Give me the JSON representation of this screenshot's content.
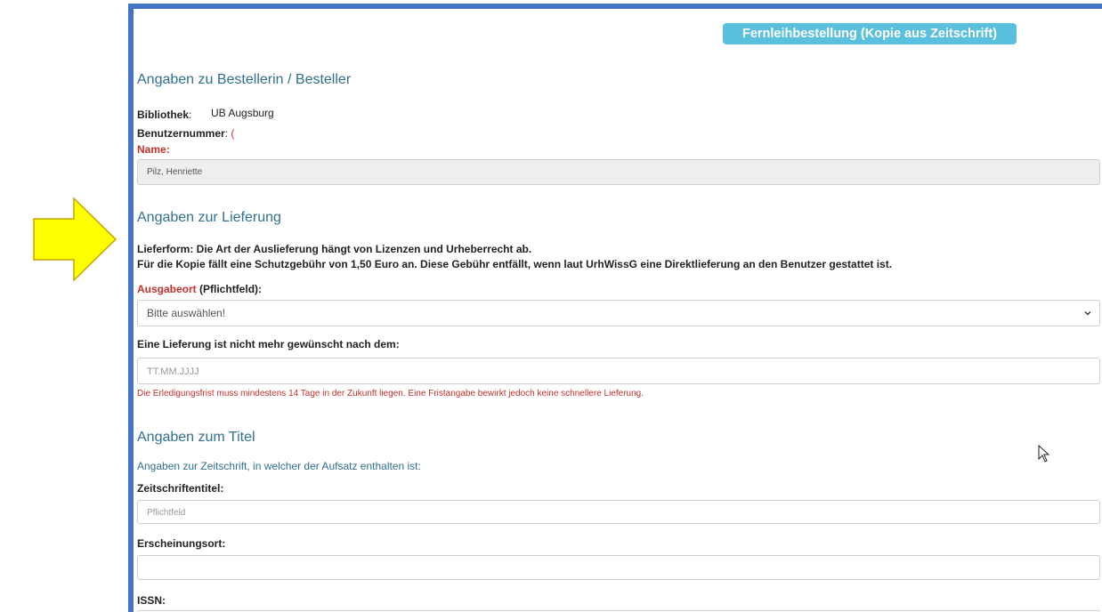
{
  "header": {
    "title": "Fernleihbestellung (Kopie aus Zeitschrift)"
  },
  "orderer": {
    "heading": "Angaben zu Bestellerin / Besteller",
    "library_label": "Bibliothek",
    "library_value": "UB Augsburg",
    "user_number_label": "Benutzernummer",
    "user_number_value": "(",
    "name_label": "Name",
    "name_value": "Pilz, Henriette"
  },
  "delivery": {
    "heading": "Angaben zur Lieferung",
    "info_line1": "Lieferform: Die Art der Auslieferung hängt von Lizenzen und Urheberrecht ab.",
    "info_line2": "Für die Kopie fällt eine Schutzgebühr von 1,50 Euro an. Diese Gebühr entfällt, wenn laut UrhWissG eine Direktlieferung an den Benutzer gestattet ist.",
    "pickup_label_required": "Ausgabeort",
    "pickup_label_suffix": " (Pflichtfeld):",
    "pickup_selected": "Bitte auswählen!",
    "deadline_label": "Eine Lieferung ist nicht mehr gewünscht nach dem:",
    "deadline_placeholder": "TT.MM.JJJJ",
    "deadline_note": "Die Erledigungsfrist muss mindestens 14 Tage in der Zukunft liegen. Eine Fristangabe bewirkt jedoch keine schnellere Lieferung."
  },
  "title_info": {
    "heading": "Angaben zum Titel",
    "hint": "Angaben zur Zeitschrift, in welcher der Aufsatz enthalten ist:",
    "journal_label": "Zeitschriftentitel:",
    "journal_placeholder": "Pflichtfeld",
    "place_label": "Erscheinungsort:",
    "issn_label": "ISSN:"
  },
  "colors": {
    "frame_border": "#4472c4",
    "badge": "#5bc0de",
    "heading": "#31708f",
    "required": "#c9302c",
    "arrow_fill": "#ffff00",
    "arrow_stroke": "#c9a400"
  }
}
